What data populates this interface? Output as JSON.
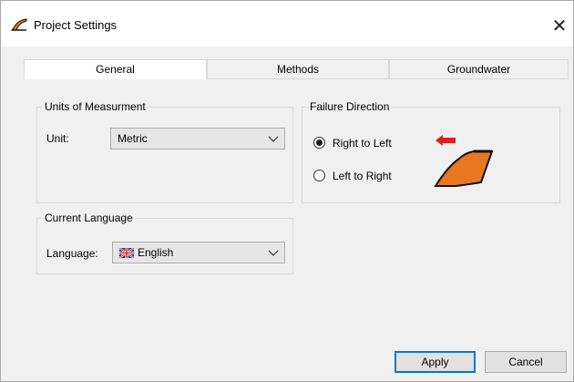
{
  "window": {
    "title": "Project Settings",
    "app_icon": "slope-app-icon",
    "close_glyph": "✕"
  },
  "tabs": [
    {
      "label": "General",
      "active": true
    },
    {
      "label": "Methods",
      "active": false
    },
    {
      "label": "Groundwater",
      "active": false
    }
  ],
  "units": {
    "group_label": "Units of Measurment",
    "unit_label": "Unit:",
    "unit_value": "Metric"
  },
  "failure": {
    "group_label": "Failure Direction",
    "options": [
      {
        "label": "Right to Left",
        "selected": true
      },
      {
        "label": "Left to Right",
        "selected": false
      }
    ]
  },
  "language": {
    "group_label": "Current Language",
    "language_label": "Language:",
    "language_value": "English",
    "flag_icon": "uk-flag-icon"
  },
  "buttons": {
    "apply_label": "Apply",
    "cancel_label": "Cancel"
  },
  "colors": {
    "accent": "#0078d7",
    "slope_fill": "#e87722",
    "arrow_red": "#e02020"
  }
}
